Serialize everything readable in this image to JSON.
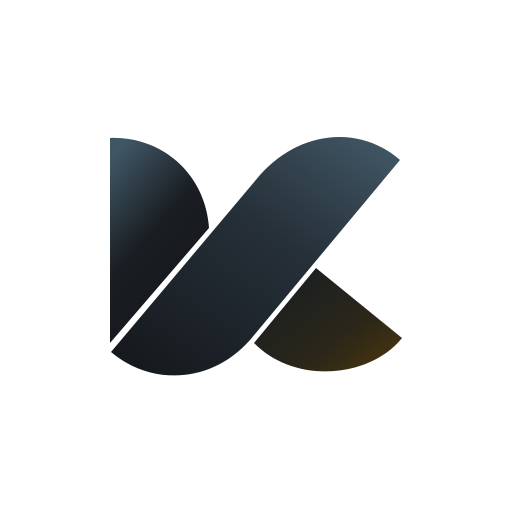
{
  "logo": {
    "name": "k-logo-mark",
    "colors": {
      "background": "#ffffff",
      "slate_light": "#3f5664",
      "slate_dark": "#1a1e22",
      "amber_dark": "#4a3510",
      "mid_dark": "#2a3640"
    }
  }
}
